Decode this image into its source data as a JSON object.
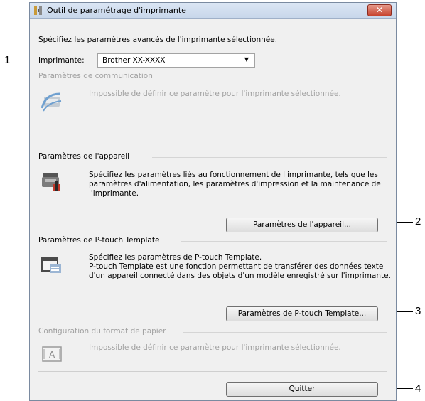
{
  "callouts": [
    "1",
    "2",
    "3",
    "4"
  ],
  "window": {
    "title": "Outil de paramétrage d'imprimante",
    "close_label": "✕"
  },
  "intro": "Spécifiez les paramètres avancés de l'imprimante sélectionnée.",
  "printer": {
    "label": "Imprimante:",
    "value": "Brother XX-XXXX"
  },
  "comm": {
    "heading": "Paramètres de communication",
    "desc": "Impossible de définir ce paramètre pour l'imprimante sélectionnée."
  },
  "device": {
    "heading": "Paramètres de l'appareil",
    "desc": [
      "Spécifiez les paramètres liés au fonctionnement de l'imprimante, tels que les",
      "paramètres d'alimentation, les paramètres d'impression et la maintenance de",
      "l'imprimante."
    ],
    "button": "Paramètres de l'appareil..."
  },
  "template": {
    "heading": "Paramètres de P-touch Template",
    "desc": [
      "Spécifiez les paramètres de P-touch Template.",
      "P-touch Template est une fonction permettant de transférer des données texte",
      "d'un appareil connecté dans des objets d'un modèle enregistré sur l'imprimante."
    ],
    "button": "Paramètres de P-touch Template..."
  },
  "paper": {
    "heading": "Configuration du format de papier",
    "desc": "Impossible de définir ce paramètre pour l'imprimante sélectionnée."
  },
  "quit": "Quitter"
}
